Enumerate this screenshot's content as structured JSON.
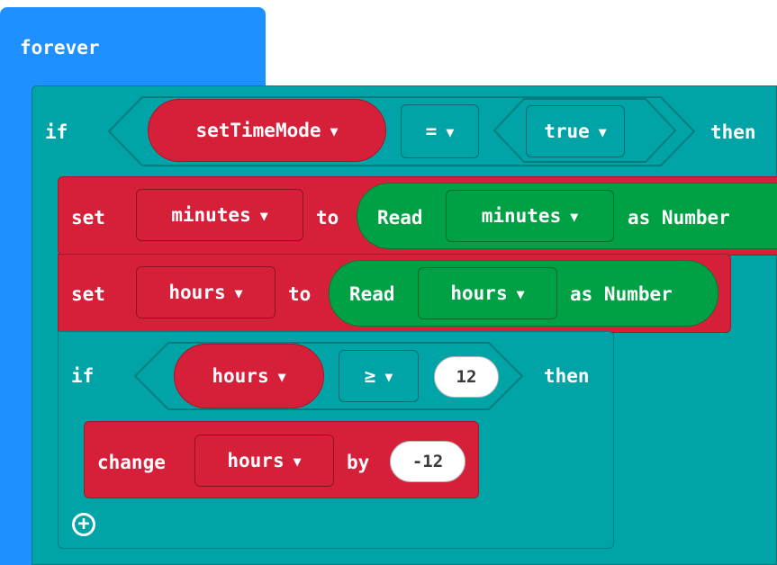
{
  "forever": {
    "label": "forever"
  },
  "if_outer": {
    "if_label": "if",
    "then_label": "then",
    "variable": "setTimeMode",
    "operator": "=",
    "value": "true"
  },
  "set_minutes": {
    "set_label": "set",
    "variable": "minutes",
    "to_label": "to",
    "read_label": "Read",
    "read_variable": "minutes",
    "as_label": "as Number"
  },
  "set_hours": {
    "set_label": "set",
    "variable": "hours",
    "to_label": "to",
    "read_label": "Read",
    "read_variable": "hours",
    "as_label": "as Number"
  },
  "if_inner": {
    "if_label": "if",
    "then_label": "then",
    "variable": "hours",
    "operator": "≥",
    "value": "12"
  },
  "change_hours": {
    "change_label": "change",
    "variable": "hours",
    "by_label": "by",
    "value": "-12"
  },
  "icons": {
    "caret": "▼",
    "add": "+"
  },
  "colors": {
    "loops": "#1e90ff",
    "logic": "#00a4a6",
    "variables": "#d6203a",
    "functions": "#00a045"
  }
}
